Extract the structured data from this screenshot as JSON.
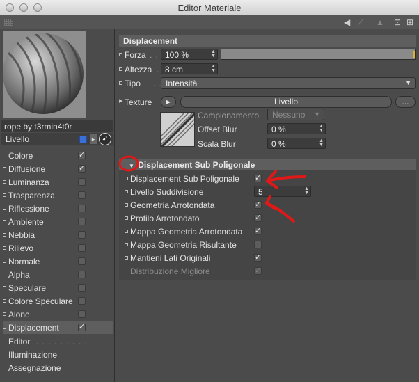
{
  "window": {
    "title": "Editor Materiale"
  },
  "toolbar": {
    "icons": [
      "back-arrow-icon",
      "forward-arrow-icon",
      "up-arrow-icon",
      "lock-icon",
      "new-window-icon"
    ]
  },
  "material": {
    "name": "rope by t3rmin4t0r",
    "level_label": "Livello"
  },
  "channels": [
    {
      "label": "Colore",
      "checked": true
    },
    {
      "label": "Diffusione",
      "checked": true
    },
    {
      "label": "Luminanza",
      "checked": false
    },
    {
      "label": "Trasparenza",
      "checked": false
    },
    {
      "label": "Riflessione",
      "checked": false
    },
    {
      "label": "Ambiente",
      "checked": false
    },
    {
      "label": "Nebbia",
      "checked": false
    },
    {
      "label": "Rilievo",
      "checked": false
    },
    {
      "label": "Normale",
      "checked": false
    },
    {
      "label": "Alpha",
      "checked": false
    },
    {
      "label": "Speculare",
      "checked": false
    },
    {
      "label": "Colore Speculare",
      "checked": false
    },
    {
      "label": "Alone",
      "checked": false
    },
    {
      "label": "Displacement",
      "checked": true
    }
  ],
  "extra_items": [
    "Editor",
    "Illuminazione",
    "Assegnazione"
  ],
  "displacement": {
    "header": "Displacement",
    "forza_label": "Forza",
    "forza_value": "100 %",
    "forza_fraction": 1.0,
    "altezza_label": "Altezza",
    "altezza_value": "8 cm",
    "tipo_label": "Tipo",
    "tipo_value": "Intensità",
    "texture_label": "Texture",
    "texture_button": "Livello",
    "more_button": "...",
    "campionamento_label": "Campionamento",
    "campionamento_value": "Nessuno",
    "offset_label": "Offset Blur",
    "offset_value": "0 %",
    "scala_label": "Scala Blur",
    "scala_value": "0 %"
  },
  "subpoly": {
    "header": "Displacement Sub Poligonale",
    "rows": [
      {
        "label": "Displacement Sub Poligonale",
        "type": "check",
        "checked": true,
        "enabled": true
      },
      {
        "label": "Livello Suddivisione",
        "type": "field",
        "value": "5",
        "enabled": true
      },
      {
        "label": "Geometria Arrotondata",
        "type": "check",
        "checked": true,
        "enabled": true
      },
      {
        "label": "Profilo Arrotondato",
        "type": "check",
        "checked": true,
        "enabled": true
      },
      {
        "label": "Mappa Geometria Arrotondata",
        "type": "check",
        "checked": true,
        "enabled": true
      },
      {
        "label": "Mappa Geometria Risultante",
        "type": "check",
        "checked": false,
        "enabled": true
      },
      {
        "label": "Mantieni Lati Originali",
        "type": "check",
        "checked": true,
        "enabled": true
      },
      {
        "label": "Distribuzione Migliore",
        "type": "check",
        "checked": true,
        "enabled": false
      }
    ]
  },
  "colors": {
    "accent_blue": "#3a6fd8",
    "annotation_red": "#e01818",
    "slider_mark": "#e0b030"
  }
}
